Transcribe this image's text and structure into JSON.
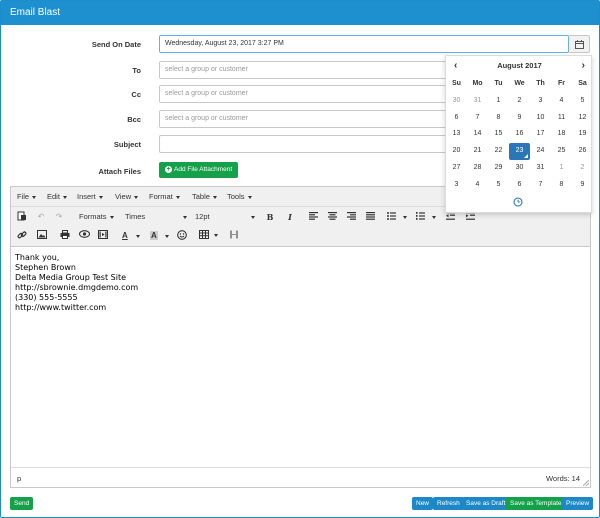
{
  "panel": {
    "title": "Email Blast"
  },
  "form": {
    "send_on_date": {
      "label": "Send On Date",
      "value": "Wednesday, August 23, 2017 3:27 PM"
    },
    "to": {
      "label": "To",
      "placeholder": "select a group or customer"
    },
    "cc": {
      "label": "Cc",
      "placeholder": "select a group or customer"
    },
    "bcc": {
      "label": "Bcc",
      "placeholder": "select a group or customer"
    },
    "subject": {
      "label": "Subject",
      "value": ""
    },
    "attach": {
      "label": "Attach Files",
      "button": "Add File Attachment"
    }
  },
  "editor": {
    "menu": [
      "File",
      "Edit",
      "Insert",
      "View",
      "Format",
      "Table",
      "Tools"
    ],
    "toolbar": {
      "formats": "Formats",
      "font": "Times",
      "size": "12pt"
    },
    "content_lines": [
      "Thank you,",
      "Stephen Brown",
      "Delta Media Group Test Site",
      "http://sbrownie.dmgdemo.com",
      "(330) 555-5555",
      "http://www.twitter.com"
    ],
    "status_path": "p",
    "word_count": "Words: 14"
  },
  "datepicker": {
    "month_title": "August 2017",
    "prev": "‹",
    "next": "›",
    "weekdays": [
      "Su",
      "Mo",
      "Tu",
      "We",
      "Th",
      "Fr",
      "Sa"
    ],
    "weeks": [
      [
        "30",
        "31",
        "1",
        "2",
        "3",
        "4",
        "5"
      ],
      [
        "6",
        "7",
        "8",
        "9",
        "10",
        "11",
        "12"
      ],
      [
        "13",
        "14",
        "15",
        "16",
        "17",
        "18",
        "19"
      ],
      [
        "20",
        "21",
        "22",
        "23",
        "24",
        "25",
        "26"
      ],
      [
        "27",
        "28",
        "29",
        "30",
        "31",
        "1",
        "2"
      ],
      [
        "3",
        "4",
        "5",
        "6",
        "7",
        "8",
        "9"
      ]
    ],
    "selected": "23"
  },
  "footer": {
    "send": "Send",
    "new": "New",
    "refresh": "Refresh",
    "save_draft": "Save as Draft",
    "save_template": "Save as Template",
    "preview": "Preview"
  },
  "colors": {
    "header": "#1e90d0",
    "green": "#15a04a",
    "blue": "#1e88c7",
    "selected_day": "#2a77b8"
  }
}
